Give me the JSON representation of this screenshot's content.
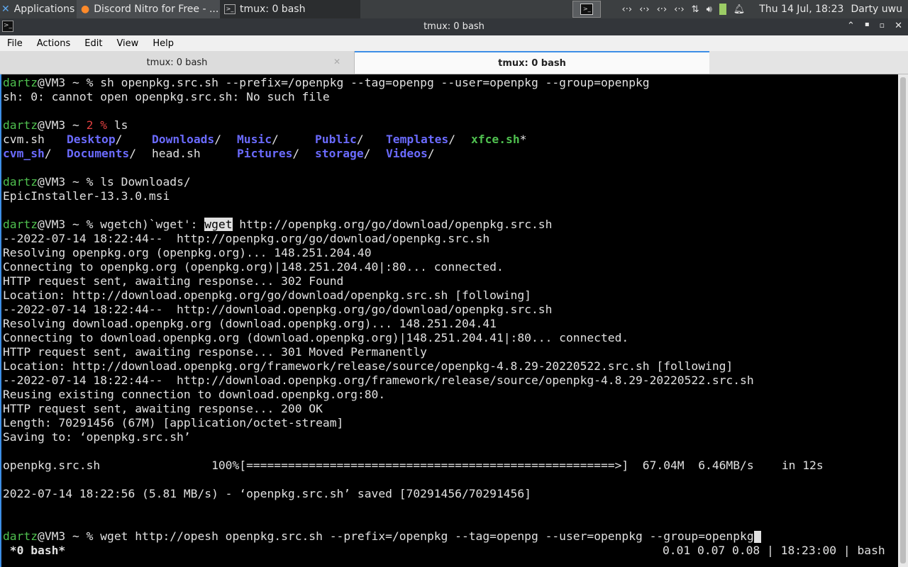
{
  "panel": {
    "apps_label": "Applications",
    "task1_label": "Discord Nitro for Free - ...",
    "task2_label": "tmux: 0 bash",
    "clock": "Thu 14 Jul, 18:23",
    "user": "Darty uwu"
  },
  "window": {
    "title": "tmux: 0 bash",
    "menu": [
      "File",
      "Actions",
      "Edit",
      "View",
      "Help"
    ],
    "tabs": [
      "tmux: 0 bash",
      "tmux: 0 bash"
    ]
  },
  "terminal": {
    "user": "dartz",
    "host_prompt": "@VM3 ~ ",
    "l1_cmd": "% sh openpkg.src.sh --prefix=/openpkg --tag=openpg --user=openpkg --group=openpkg",
    "l2": "sh: 0: cannot open openpkg.src.sh: No such file",
    "l4_err": "2 %",
    "l4_cmd": " ls",
    "ls1": [
      "cvm.sh",
      "Desktop",
      "Downloads",
      "Music",
      "Public",
      "Templates",
      "xfce.sh"
    ],
    "ls2": [
      "cvm_sh",
      "Documents",
      "head.sh",
      "Pictures",
      "storage",
      "Videos"
    ],
    "l7_cmd": "% ls Downloads/",
    "l8": "EpicInstaller-13.3.0.msi",
    "l10_cmd_a": "% wgetch)`wget': ",
    "l10_hl": "wget",
    "l10_cmd_b": " http://openpkg.org/go/download/openpkg.src.sh",
    "out": [
      "--2022-07-14 18:22:44--  http://openpkg.org/go/download/openpkg.src.sh",
      "Resolving openpkg.org (openpkg.org)... 148.251.204.40",
      "Connecting to openpkg.org (openpkg.org)|148.251.204.40|:80... connected.",
      "HTTP request sent, awaiting response... 302 Found",
      "Location: http://download.openpkg.org/go/download/openpkg.src.sh [following]",
      "--2022-07-14 18:22:44--  http://download.openpkg.org/go/download/openpkg.src.sh",
      "Resolving download.openpkg.org (download.openpkg.org)... 148.251.204.41",
      "Connecting to download.openpkg.org (download.openpkg.org)|148.251.204.41|:80... connected.",
      "HTTP request sent, awaiting response... 301 Moved Permanently",
      "Location: http://download.openpkg.org/framework/release/source/openpkg-4.8.29-20220522.src.sh [following]",
      "--2022-07-14 18:22:44--  http://download.openpkg.org/framework/release/source/openpkg-4.8.29-20220522.src.sh",
      "Reusing existing connection to download.openpkg.org:80.",
      "HTTP request sent, awaiting response... 200 OK",
      "Length: 70291456 (67M) [application/octet-stream]",
      "Saving to: ‘openpkg.src.sh’"
    ],
    "progress": "openpkg.src.sh                100%[=====================================================>]  67.04M  6.46MB/s    in 12s",
    "saved": "2022-07-14 18:22:56 (5.81 MB/s) - ‘openpkg.src.sh’ saved [70291456/70291456]",
    "last_cmd": "% wget http://opesh openpkg.src.sh --prefix=/openpkg --tag=openpg --user=openpkg --group=openpkg",
    "status_left": " *0 bash*",
    "status_right": "0.01 0.07 0.08 | 18:23:00 | bash"
  }
}
